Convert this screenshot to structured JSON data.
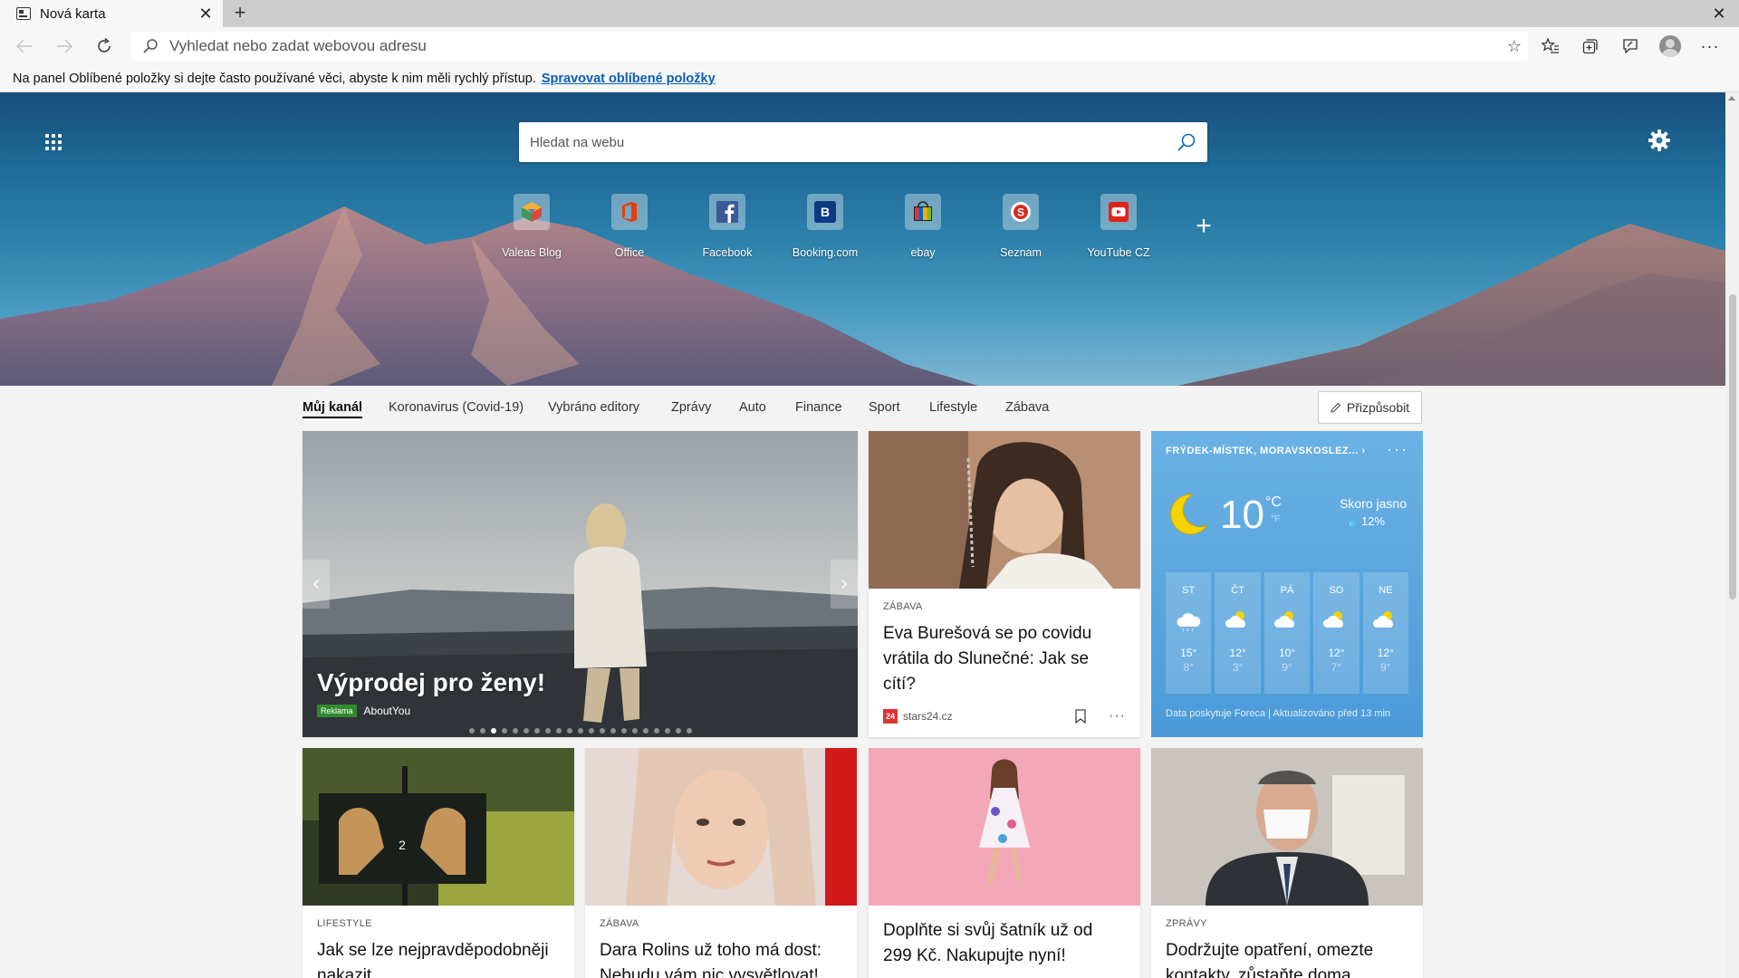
{
  "tab": {
    "title": "Nová karta"
  },
  "address": {
    "placeholder": "Vyhledat nebo zadat webovou adresu"
  },
  "favbar": {
    "message": "Na panel Oblíbené položky si dejte často používané věci, abyste k nim měli rychlý přístup.",
    "link": "Spravovat oblíbené položky"
  },
  "search": {
    "placeholder": "Hledat na webu"
  },
  "tiles": [
    {
      "label": "Valeas Blog",
      "icon": "valeas-blog-icon"
    },
    {
      "label": "Office",
      "icon": "office-icon"
    },
    {
      "label": "Facebook",
      "icon": "facebook-icon"
    },
    {
      "label": "Booking.com",
      "icon": "booking-icon"
    },
    {
      "label": "ebay",
      "icon": "ebay-icon"
    },
    {
      "label": "Seznam",
      "icon": "seznam-icon"
    },
    {
      "label": "YouTube CZ",
      "icon": "youtube-icon"
    }
  ],
  "nav": {
    "items": [
      "Můj kanál",
      "Koronavirus (Covid-19)",
      "Vybráno editory",
      "Zprávy",
      "Auto",
      "Finance",
      "Sport",
      "Lifestyle",
      "Zábava"
    ],
    "customize": "Přizpůsobit"
  },
  "carousel": {
    "title": "Výprodej pro ženy!",
    "ad_label": "Reklama",
    "sponsor": "AboutYou",
    "dots_total": 21,
    "active_dot": 3
  },
  "cards": {
    "eva": {
      "category": "ZÁBAVA",
      "headline": "Eva Burešová se po covidu vrátila do Slunečné: Jak se cítí?",
      "source_badge": "24",
      "source": "stars24.cz"
    },
    "lifestyle": {
      "category": "LIFESTYLE",
      "headline": "Jak se lze nejpravděpodobněji nakazit"
    },
    "dara": {
      "category": "ZÁBAVA",
      "headline": "Dara Rolins už toho má dost: Nebudu vám nic vysvětlovat!"
    },
    "ad": {
      "headline": "Doplňte si svůj šatník už od 299 Kč. Nakupujte nyní!"
    },
    "news": {
      "category": "ZPRÁVY",
      "headline": "Dodržujte opatření, omezte kontakty, zůstaňte doma"
    }
  },
  "weather": {
    "location": "FRÝDEK-MÍSTEK, MORAVSKOSLEZ...",
    "temp": "10",
    "unit_c": "°C",
    "unit_f": "°F",
    "condition": "Skoro jasno",
    "precip": "12%",
    "forecast": [
      {
        "day": "ST",
        "hi": "15°",
        "lo": "8°"
      },
      {
        "day": "ČT",
        "hi": "12°",
        "lo": "3°"
      },
      {
        "day": "PÁ",
        "hi": "10°",
        "lo": "9°"
      },
      {
        "day": "SO",
        "hi": "12°",
        "lo": "7°"
      },
      {
        "day": "NE",
        "hi": "12°",
        "lo": "9°"
      }
    ],
    "attribution": "Data poskytuje Foreca | Aktualizováno před 13 min"
  },
  "colors": {
    "accent_link": "#0a5fb4",
    "weather_bg": "#5aa6de",
    "ad_badge": "#2f8a2f"
  }
}
